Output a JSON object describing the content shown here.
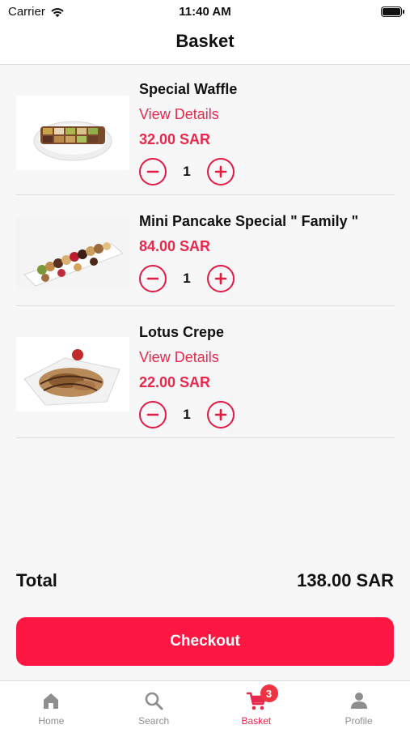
{
  "status_bar": {
    "carrier": "Carrier",
    "time": "11:40 AM"
  },
  "nav": {
    "title": "Basket"
  },
  "items": [
    {
      "name": "Special Waffle",
      "details_link": "View Details",
      "price": "32.00 SAR",
      "quantity": "1"
    },
    {
      "name": "Mini Pancake Special \" Family \"",
      "price": "84.00 SAR",
      "quantity": "1"
    },
    {
      "name": "Lotus Crepe",
      "details_link": "View Details",
      "price": "22.00 SAR",
      "quantity": "1"
    }
  ],
  "summary": {
    "total_label": "Total",
    "total_value": "138.00 SAR"
  },
  "checkout": {
    "label": "Checkout"
  },
  "tab_bar": {
    "tabs": [
      {
        "label": "Home",
        "icon": "home-icon"
      },
      {
        "label": "Search",
        "icon": "search-icon"
      },
      {
        "label": "Basket",
        "icon": "cart-icon",
        "badge": "3",
        "active": true
      },
      {
        "label": "Profile",
        "icon": "person-icon"
      }
    ]
  },
  "colors": {
    "accent": "#e8284a",
    "checkout_bg": "#ff1744",
    "badge_bg": "#f03340",
    "inactive_tab": "#8e8e8e"
  }
}
